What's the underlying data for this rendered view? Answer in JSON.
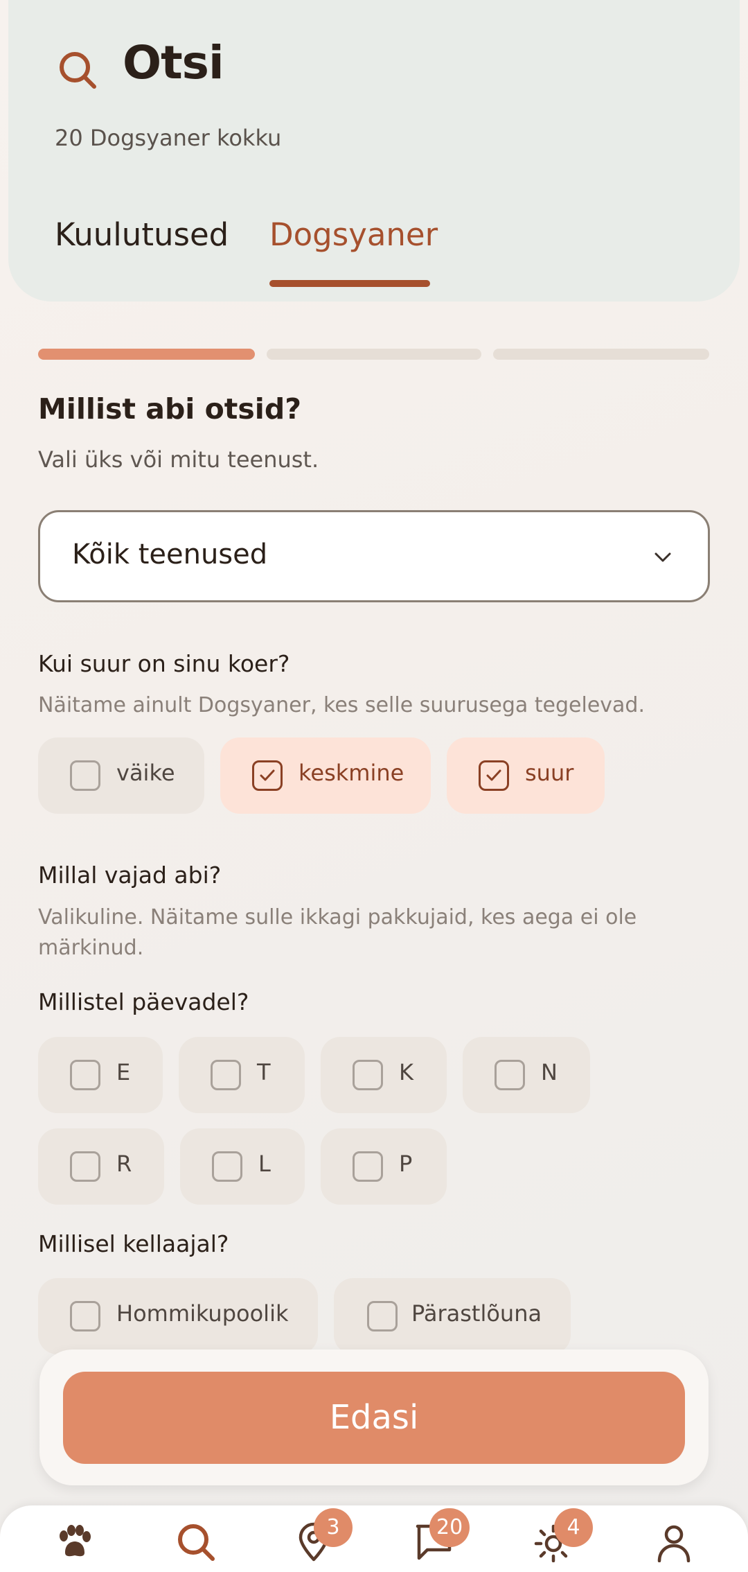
{
  "header": {
    "title": "Otsi",
    "count_text": "20 Dogsyaner kokku",
    "tabs": [
      {
        "label": "Kuulutused",
        "active": false
      },
      {
        "label": "Dogsyaner",
        "active": true
      }
    ]
  },
  "progress": {
    "steps_total": 3,
    "current_step": 1
  },
  "services": {
    "heading": "Millist abi otsid?",
    "subtext": "Vali üks või mitu teenust.",
    "select_value": "Kõik teenused"
  },
  "size": {
    "question": "Kui suur on sinu koer?",
    "hint": "Näitame ainult Dogsyaner, kes selle suurusega tegelevad.",
    "options": [
      {
        "label": "väike",
        "checked": false
      },
      {
        "label": "keskmine",
        "checked": true
      },
      {
        "label": "suur",
        "checked": true
      }
    ]
  },
  "when": {
    "question": "Millal vajad abi?",
    "hint": "Valikuline. Näitame sulle ikkagi pakkujaid, kes aega ei ole märkinud.",
    "days_label": "Millistel päevadel?",
    "days": [
      {
        "label": "E",
        "checked": false
      },
      {
        "label": "T",
        "checked": false
      },
      {
        "label": "K",
        "checked": false
      },
      {
        "label": "N",
        "checked": false
      },
      {
        "label": "R",
        "checked": false
      },
      {
        "label": "L",
        "checked": false
      },
      {
        "label": "P",
        "checked": false
      }
    ],
    "time_label": "Millisel kellaajal?",
    "times": [
      {
        "label": "Hommikupoolik",
        "checked": false
      },
      {
        "label": "Pärastlõuna",
        "checked": false
      }
    ]
  },
  "action": {
    "next_label": "Edasi"
  },
  "nav": {
    "items": [
      {
        "icon": "paw-icon",
        "badge": ""
      },
      {
        "icon": "search-icon",
        "badge": ""
      },
      {
        "icon": "location-pin-icon",
        "badge": "3"
      },
      {
        "icon": "chat-icon",
        "badge": "20"
      },
      {
        "icon": "sun-icon",
        "badge": "4"
      },
      {
        "icon": "profile-icon",
        "badge": ""
      }
    ]
  },
  "colors": {
    "accent": "#a6502d",
    "primary_button": "#e08b68",
    "header_bg": "#e8ece8",
    "chip_selected_bg": "#fde3d8"
  }
}
